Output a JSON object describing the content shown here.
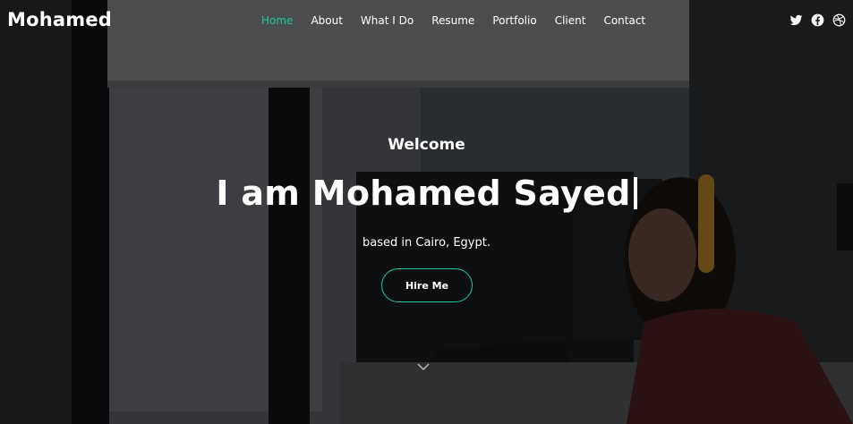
{
  "brand": "Mohamed",
  "nav": {
    "items": [
      {
        "label": "Home"
      },
      {
        "label": "About"
      },
      {
        "label": "What I Do"
      },
      {
        "label": "Resume"
      },
      {
        "label": "Portfolio"
      },
      {
        "label": "Client"
      },
      {
        "label": "Contact"
      }
    ],
    "active_index": 0
  },
  "social": [
    "twitter-icon",
    "facebook-icon",
    "dribbble-icon"
  ],
  "hero": {
    "welcome": "Welcome",
    "headline": "I am Mohamed Sayed",
    "subline": "based in Cairo, Egypt.",
    "cta": "Hire Me"
  },
  "colors": {
    "accent": "#20c997",
    "text": "#ffffff"
  }
}
